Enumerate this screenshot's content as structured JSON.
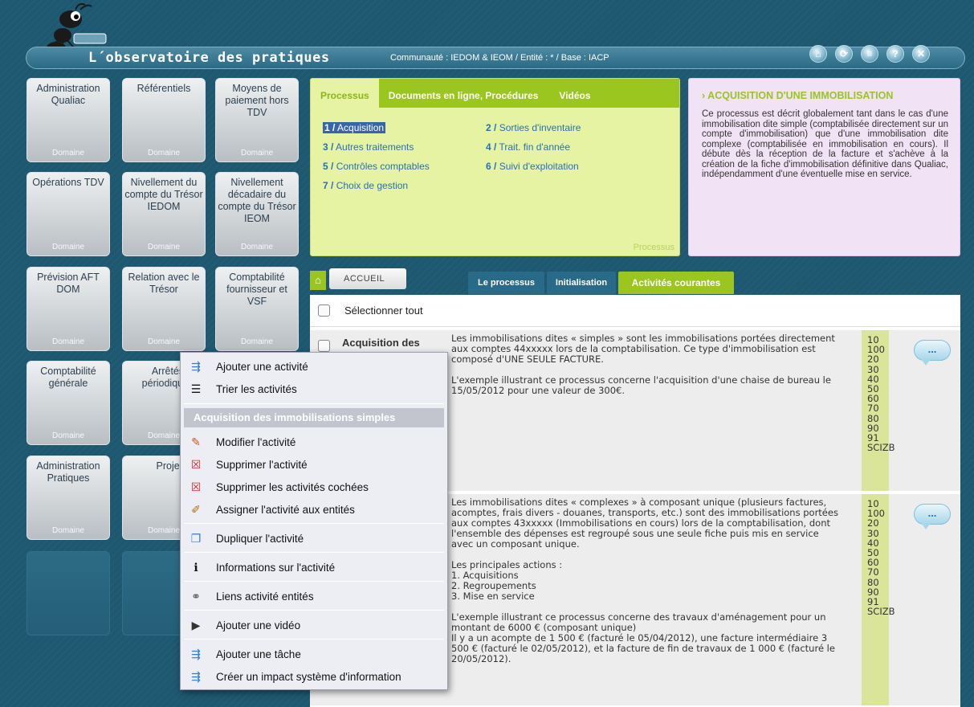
{
  "header": {
    "title": "L´observatoire des pratiques",
    "community": "Communauté : IEDOM & IEOM / Entité : * / Base : IACP",
    "icons": [
      "home-icon",
      "refresh-icon",
      "menu-icon",
      "help-icon",
      "close-icon"
    ],
    "icon_glyphs": [
      "⌂",
      "⟳",
      "≡",
      "?",
      "✕"
    ]
  },
  "tiles": [
    {
      "label": "Administration Qualiac",
      "footer": "Domaine"
    },
    {
      "label": "Référentiels",
      "footer": "Domaine"
    },
    {
      "label": "Moyens de paiement hors TDV",
      "footer": "Domaine"
    },
    {
      "label": "Opérations TDV",
      "footer": "Domaine"
    },
    {
      "label": "Nivellement du compte du Trésor IEDOM",
      "footer": "Domaine"
    },
    {
      "label": "Nivellement décadaire du compte du Trésor IEOM",
      "footer": "Domaine"
    },
    {
      "label": "Prévision AFT DOM",
      "footer": "Domaine"
    },
    {
      "label": "Relation avec le Trésor",
      "footer": "Domaine"
    },
    {
      "label": "Comptabilité fournisseur et VSF",
      "footer": "Domaine"
    },
    {
      "label": "Comptabilité générale",
      "footer": "Domaine"
    },
    {
      "label": "Arrêtés périodiques",
      "footer": "Domaine"
    },
    {
      "label": "",
      "footer": ""
    },
    {
      "label": "Administration Pratiques",
      "footer": "Domaine"
    },
    {
      "label": "Projets",
      "footer": "Domaine"
    }
  ],
  "process_panel": {
    "tabs": [
      "Processus",
      "Documents en ligne, Procédures",
      "Vidéos"
    ],
    "links": [
      {
        "num": "1 /",
        "label": "Acquisition"
      },
      {
        "num": "2 /",
        "label": "Sorties d'inventaire"
      },
      {
        "num": "3 /",
        "label": "Autres traitements"
      },
      {
        "num": "4 /",
        "label": "Trait. fin d'année"
      },
      {
        "num": "5 /",
        "label": "Contrôles comptables"
      },
      {
        "num": "6 /",
        "label": "Suivi d'exploitation"
      },
      {
        "num": "7 /",
        "label": "Choix de gestion"
      }
    ],
    "footer": "Processus"
  },
  "info_panel": {
    "title": "› ACQUISITION D'UNE IMMOBILISATION",
    "text": "Ce processus est décrit globalement tant dans le cas d'une immobilisation dite simple (comptabilisée directement sur un compte d'immobilisation) que d'une immobilisation dite complexe (comptabilisée en immobilisation en cours). Il débute dès la réception de la facture et s'achève à la création de la fiche d'immobilisation définitive dans Qualiac, indépendamment d'une éventuelle mise en service."
  },
  "tabs_bar": {
    "home_glyph": "⌂",
    "accueil": "ACCUEIL",
    "tabs": [
      "Le processus",
      "Initialisation",
      "Activités courantes"
    ]
  },
  "list": {
    "select_all": "Sélectionner tout",
    "rows": [
      {
        "name": "Acquisition des",
        "desc": "Les immobilisations dites « simples » sont les immobilisations portées directement aux comptes 44xxxxx lors de la comptabilisation. Ce type d'immobilisation est composé d'UNE SEULE FACTURE.\n\nL'exemple illustrant ce processus concerne l'acquisition d'une chaise de bureau le 15/05/2012 pour une valeur de 300€.",
        "codes": [
          "10",
          "100",
          "20",
          "30",
          "40",
          "50",
          "60",
          "70",
          "80",
          "90",
          "91",
          "SCIZB"
        ],
        "bubble": "..."
      },
      {
        "name": "",
        "desc": "Les immobilisations dites « complexes » à composant unique (plusieurs factures, acomptes, frais divers - douanes, transports, etc.) sont des immobilisations portées aux comptes 43xxxxx (Immobilisations en cours) lors de la comptabilisation, dont l'ensemble des dépenses est regroupé sous une seule fiche puis mis en service avec un composant unique.\n\nLes principales actions :\n1. Acquisitions\n2. Regroupements\n3. Mise en service\n\nL'exemple illustrant ce processus concerne des travaux d'aménagement pour un montant de 6000 € (composant unique)\nIl y a un acompte de 1 500 € (facturé le 05/04/2012), une facture intermédiaire 3 500 € (facturé le 02/05/2012), et la facture de fin de travaux de 1 000 € (facturé le 20/05/2012).",
        "codes": [
          "10",
          "100",
          "20",
          "30",
          "40",
          "50",
          "60",
          "70",
          "80",
          "90",
          "91",
          "SCIZB"
        ],
        "bubble": "..."
      }
    ]
  },
  "context_menu": {
    "header": "Acquisition des immobilisations simples",
    "items": [
      {
        "label": "Ajouter une activité",
        "icon": "add-activity-icon",
        "glyph": "⇶"
      },
      {
        "label": "Trier les activités",
        "icon": "sort-list-icon",
        "glyph": "☰"
      },
      {
        "label": "Modifier l'activité",
        "icon": "pencil-icon",
        "glyph": "✎"
      },
      {
        "label": "Supprimer l'activité",
        "icon": "delete-icon",
        "glyph": "☒"
      },
      {
        "label": "Supprimer les activités cochées",
        "icon": "delete-checked-icon",
        "glyph": "☒"
      },
      {
        "label": "Assigner l'activité aux entités",
        "icon": "paint-brush-icon",
        "glyph": "✐"
      },
      {
        "label": "Dupliquer l'activité",
        "icon": "duplicate-icon",
        "glyph": "❐"
      },
      {
        "label": "Informations sur l'activité",
        "icon": "info-icon",
        "glyph": "ℹ"
      },
      {
        "label": "Liens activité entités",
        "icon": "link-icon",
        "glyph": "⚭"
      },
      {
        "label": "Ajouter une vidéo",
        "icon": "video-camera-icon",
        "glyph": "▶"
      },
      {
        "label": "Ajouter une tâche",
        "icon": "add-task-icon",
        "glyph": "⇶"
      },
      {
        "label": "Créer un impact système d'information",
        "icon": "impact-icon",
        "glyph": "⇶"
      }
    ]
  },
  "colors": {
    "background": "#1e5770",
    "accent_green": "#9bc620",
    "panel_green": "#e6f3a3",
    "panel_pink": "#f2e2f5",
    "link_blue": "#2a6fb5"
  }
}
